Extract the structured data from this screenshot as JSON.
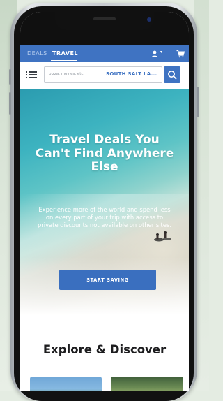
{
  "nav": {
    "tabs": [
      {
        "label": "DEALS",
        "active": false
      },
      {
        "label": "TRAVEL",
        "active": true
      }
    ],
    "icons": [
      "user-icon",
      "chevron-down-icon",
      "cart-icon"
    ]
  },
  "search": {
    "placeholder": "pizza, movies, etc.",
    "location": "SOUTH SALT LA...",
    "icons": [
      "menu-icon",
      "search-icon"
    ]
  },
  "hero": {
    "title": "Travel Deals You Can't Find Anywhere Else",
    "subtitle": "Experience more of the world and spend less on every part of your trip with access to private discounts not available on other sites.",
    "cta_label": "START SAVING"
  },
  "explore": {
    "title": "Explore & Discover"
  },
  "colors": {
    "brand": "#3f73c2",
    "cta": "#3a6fbf",
    "background": "#e4ece2"
  }
}
